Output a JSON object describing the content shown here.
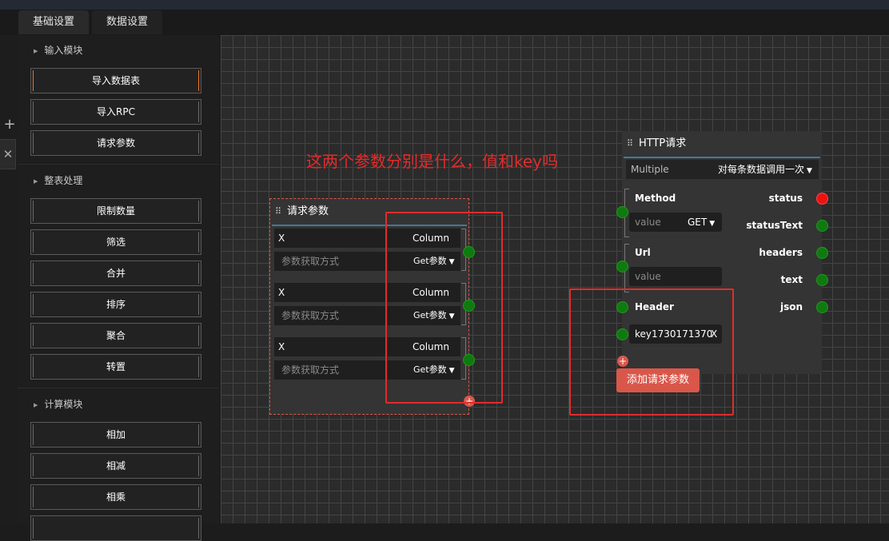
{
  "tabs": {
    "basic": "基础设置",
    "data": "数据设置"
  },
  "sidebar": {
    "sections": [
      {
        "label": "输入模块",
        "items": [
          "导入数据表",
          "导入RPC",
          "请求参数"
        ]
      },
      {
        "label": "整表处理",
        "items": [
          "限制数量",
          "筛选",
          "合并",
          "排序",
          "聚合",
          "转置"
        ]
      },
      {
        "label": "计算模块",
        "items": [
          "相加",
          "相减",
          "相乘"
        ]
      }
    ]
  },
  "annotation": "这两个参数分别是什么，值和key吗",
  "request_node": {
    "title": "请求参数",
    "params": [
      {
        "name": "X",
        "column": "Column",
        "placeholder": "参数获取方式",
        "method": "Get参数"
      },
      {
        "name": "X",
        "column": "Column",
        "placeholder": "参数获取方式",
        "method": "Get参数"
      },
      {
        "name": "X",
        "column": "Column",
        "placeholder": "参数获取方式",
        "method": "Get参数"
      }
    ]
  },
  "http_node": {
    "title": "HTTP请求",
    "mode_label": "Multiple",
    "mode_value": "对每条数据调用一次",
    "method_label": "Method",
    "method_placeholder": "value",
    "method_value": "GET",
    "url_label": "Url",
    "url_placeholder": "value",
    "header_label": "Header",
    "header_key": "key1730171370",
    "header_remove": "X",
    "add_param": "添加请求参数",
    "outputs": [
      "status",
      "statusText",
      "headers",
      "text",
      "json"
    ]
  },
  "colors": {
    "accent": "#e6772d",
    "annotation": "#e02c2c",
    "port_green": "#0f7a0f",
    "port_red": "#ee1111",
    "add_button": "#d9574a"
  }
}
